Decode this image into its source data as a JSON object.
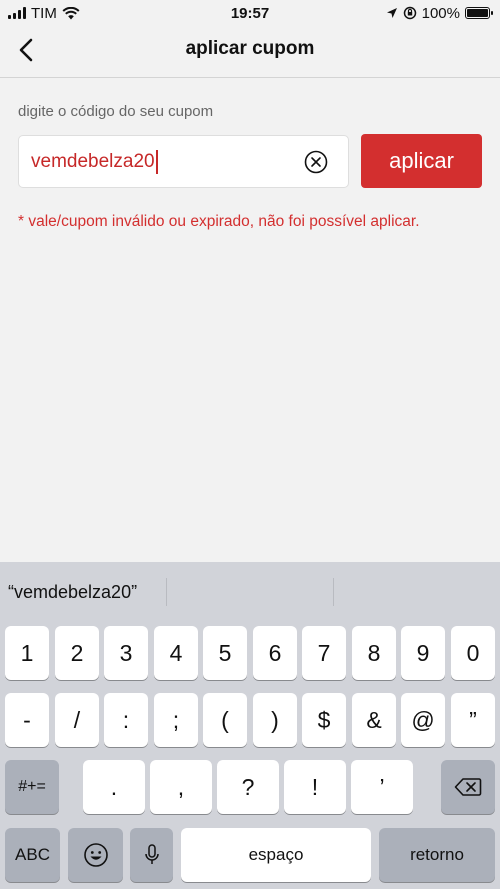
{
  "status_bar": {
    "carrier": "TIM",
    "time": "19:57",
    "battery": "100%"
  },
  "nav": {
    "title": "aplicar cupom"
  },
  "form": {
    "label": "digite o código do seu cupom",
    "coupon_value": "vemdebelza20",
    "apply_label": "aplicar",
    "error": "* vale/cupom inválido ou expirado, não foi possível aplicar."
  },
  "keyboard": {
    "suggestion": "“vemdebelza20”",
    "row1": [
      "1",
      "2",
      "3",
      "4",
      "5",
      "6",
      "7",
      "8",
      "9",
      "0"
    ],
    "row2": [
      "-",
      "/",
      ":",
      ";",
      "(",
      ")",
      "$",
      "&",
      "@",
      "”"
    ],
    "row3_shift": "#+=",
    "row3": [
      ".",
      ",",
      "?",
      "!",
      "’"
    ],
    "abc": "ABC",
    "space": "espaço",
    "return": "retorno"
  },
  "colors": {
    "accent": "#d32f2f",
    "background": "#f2f2f2"
  }
}
